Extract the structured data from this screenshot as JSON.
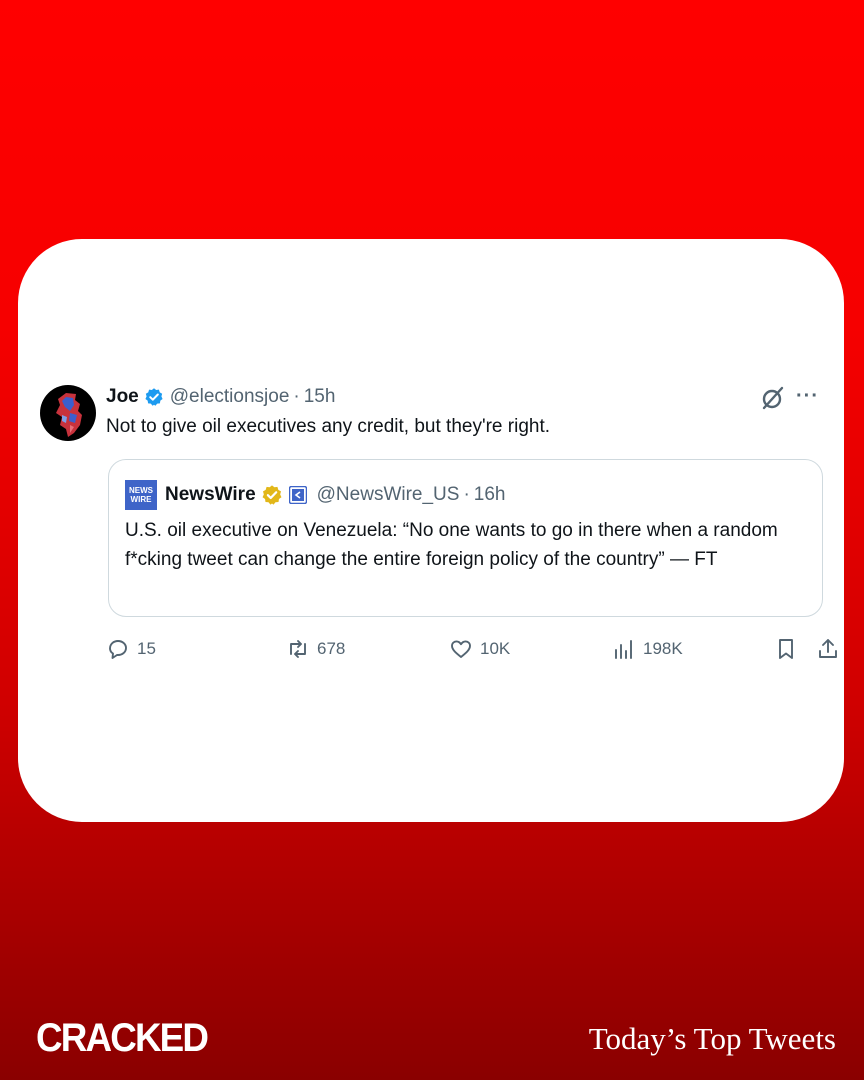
{
  "tweet": {
    "author_name": "Joe",
    "handle": "@electionsjoe",
    "separator": "·",
    "time": "15h",
    "text": "Not to give oil executives any credit, but they're right."
  },
  "quote": {
    "logo_text_top": "NEWS",
    "logo_text_bottom": "WIRE",
    "author_name": "NewsWire",
    "handle": "@NewsWire_US",
    "separator": "·",
    "time": "16h",
    "text": "U.S. oil executive on Venezuela: “No one wants to go in there when a random f*cking tweet can change the entire foreign policy of the country” — FT"
  },
  "actions": {
    "replies": "15",
    "reposts": "678",
    "likes": "10K",
    "views": "198K"
  },
  "footer": {
    "brand": "CRACKED",
    "tagline": "Today’s Top Tweets"
  },
  "colors": {
    "verified_blue": "#1d9bf0",
    "verified_gold": "#e2b719",
    "muted_text": "#536471",
    "background_red": "#ff0000"
  },
  "icons": [
    "verified-badge-icon",
    "gold-verified-badge-icon",
    "grok-icon",
    "more-icon",
    "reply-icon",
    "repost-icon",
    "like-icon",
    "views-icon",
    "bookmark-icon",
    "share-icon"
  ]
}
